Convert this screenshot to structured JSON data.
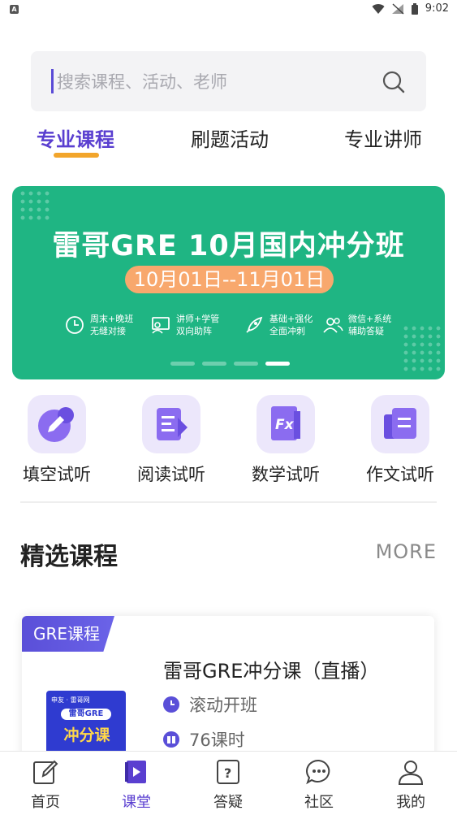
{
  "status_bar": {
    "time": "9:02",
    "left_badge": "A"
  },
  "search": {
    "placeholder": "搜索课程、活动、老师"
  },
  "tabs": [
    {
      "label": "专业课程",
      "active": true
    },
    {
      "label": "刷题活动",
      "active": false
    },
    {
      "label": "专业讲师",
      "active": false
    }
  ],
  "banner": {
    "title": "雷哥GRE 10月国内冲分班",
    "date_range": "10月01日--11月01日",
    "features": [
      {
        "line1": "周末+晚班",
        "line2": "无缝对接",
        "icon": "clock-icon"
      },
      {
        "line1": "讲师+学管",
        "line2": "双向助阵",
        "icon": "teacher-icon"
      },
      {
        "line1": "基础+强化",
        "line2": "全面冲刺",
        "icon": "rocket-icon"
      },
      {
        "line1": "微信+系统",
        "line2": "辅助答疑",
        "icon": "users-icon"
      }
    ],
    "carousel_active_index": 3,
    "carousel_count": 4,
    "background_color": "#1fb583",
    "pill_color": "#f8a86d"
  },
  "quick_entries": [
    {
      "label": "填空试听",
      "icon": "pencil-chat-icon"
    },
    {
      "label": "阅读试听",
      "icon": "document-icon"
    },
    {
      "label": "数学试听",
      "icon": "fx-book-icon"
    },
    {
      "label": "作文试听",
      "icon": "essay-icon"
    }
  ],
  "section": {
    "title": "精选课程",
    "more_label": "MORE"
  },
  "course_card": {
    "tag": "GRE课程",
    "title": "雷哥GRE冲分课（直播）",
    "schedule": "滚动开班",
    "lessons": "76课时",
    "cover": {
      "brand": "申友 · 雷哥网",
      "subtitle": "雷哥GRE",
      "main": "冲分课"
    }
  },
  "bottom_nav": [
    {
      "label": "首页",
      "icon": "pencil-square-icon",
      "active": false
    },
    {
      "label": "课堂",
      "icon": "play-book-icon",
      "active": true
    },
    {
      "label": "答疑",
      "icon": "question-icon",
      "active": false
    },
    {
      "label": "社区",
      "icon": "chat-dots-icon",
      "active": false
    },
    {
      "label": "我的",
      "icon": "person-icon",
      "active": false
    }
  ],
  "colors": {
    "accent": "#5a3fd0",
    "tab_underline": "#f2a52b",
    "icon_bg": "#ece7fb"
  }
}
